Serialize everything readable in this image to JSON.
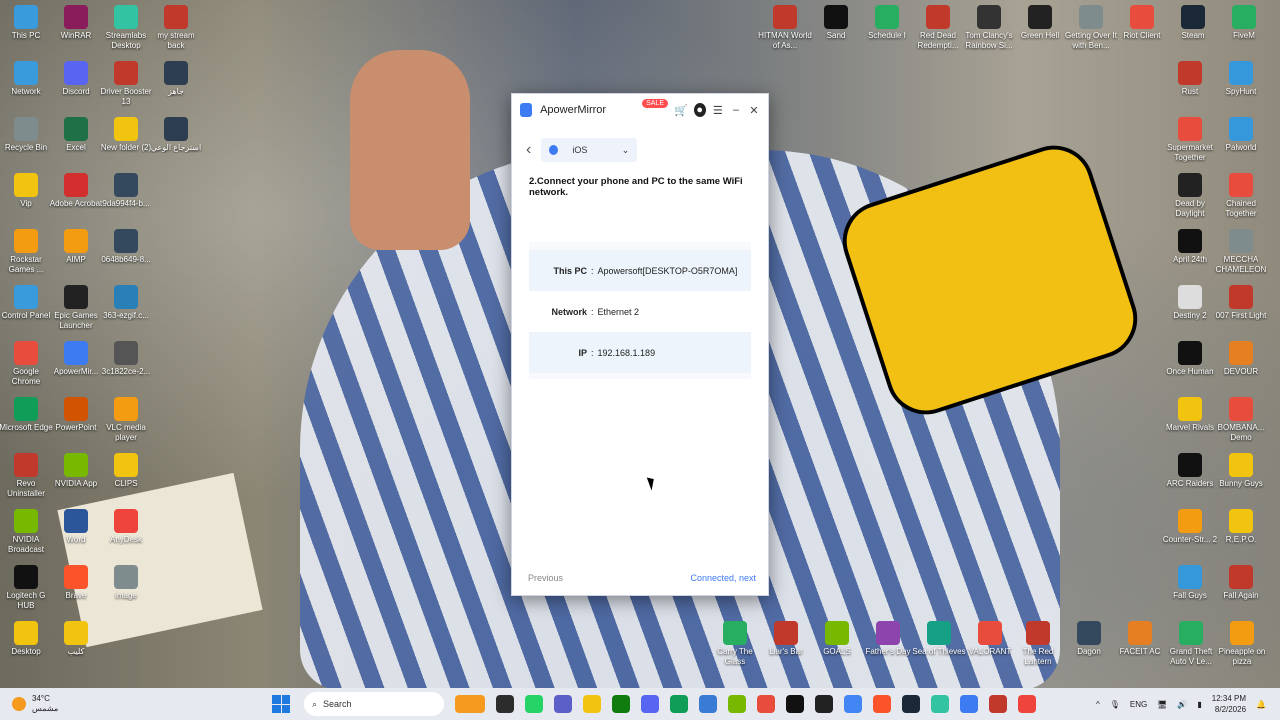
{
  "desktop": {
    "left_icons": [
      {
        "label": "This PC",
        "color": "#3a9bdc"
      },
      {
        "label": "WinRAR",
        "color": "#8a1c5c"
      },
      {
        "label": "Streamlabs Desktop",
        "color": "#31c3a2"
      },
      {
        "label": "my stream back",
        "color": "#c0392b"
      },
      {
        "label": "Network",
        "color": "#3a9bdc"
      },
      {
        "label": "Discord",
        "color": "#5865f2"
      },
      {
        "label": "Driver Booster 13",
        "color": "#c0392b"
      },
      {
        "label": "جاهز",
        "color": "#2c3e50"
      },
      {
        "label": "Recycle Bin",
        "color": "#7f8c8d"
      },
      {
        "label": "Excel",
        "color": "#1e7145"
      },
      {
        "label": "New folder (2)",
        "color": "#f1c40f"
      },
      {
        "label": "استرجاع الوعي",
        "color": "#2c3e50"
      },
      {
        "label": "Vip",
        "color": "#f1c40f"
      },
      {
        "label": "Adobe Acrobat",
        "color": "#d32f2f"
      },
      {
        "label": "9da994f4-b...",
        "color": "#34495e"
      },
      {
        "label": "Rockstar Games ...",
        "color": "#f39c12"
      },
      {
        "label": "AIMP",
        "color": "#f39c12"
      },
      {
        "label": "0648b649-8...",
        "color": "#34495e"
      },
      {
        "label": "Control Panel",
        "color": "#3a9bdc"
      },
      {
        "label": "Epic Games Launcher",
        "color": "#222"
      },
      {
        "label": "363-ezgif.c...",
        "color": "#2980b9"
      },
      {
        "label": "Google Chrome",
        "color": "#e74c3c"
      },
      {
        "label": "ApowerMir...",
        "color": "#3d7bf2"
      },
      {
        "label": "3c1822ce-2...",
        "color": "#555"
      },
      {
        "label": "Microsoft Edge",
        "color": "#0f9d58"
      },
      {
        "label": "PowerPoint",
        "color": "#d35400"
      },
      {
        "label": "VLC media player",
        "color": "#f39c12"
      },
      {
        "label": "Revo Uninstaller",
        "color": "#c0392b"
      },
      {
        "label": "NVIDIA App",
        "color": "#76b900"
      },
      {
        "label": "CLIPS",
        "color": "#f1c40f"
      },
      {
        "label": "NVIDIA Broadcast",
        "color": "#76b900"
      },
      {
        "label": "Word",
        "color": "#2b579a"
      },
      {
        "label": "AnyDesk",
        "color": "#ef443b"
      },
      {
        "label": "Logitech G HUB",
        "color": "#111"
      },
      {
        "label": "Brave",
        "color": "#fb542b"
      },
      {
        "label": "image",
        "color": "#7f8c8d"
      },
      {
        "label": "Desktop",
        "color": "#f1c40f"
      },
      {
        "label": "كليب",
        "color": "#f1c40f"
      }
    ],
    "right_icons": [
      {
        "label": "HITMAN World of As...",
        "color": "#c0392b"
      },
      {
        "label": "Sand",
        "color": "#111"
      },
      {
        "label": "Schedule I",
        "color": "#27ae60"
      },
      {
        "label": "Red Dead Redempti...",
        "color": "#c0392b"
      },
      {
        "label": "Tom Clancy's Rainbow Si...",
        "color": "#333"
      },
      {
        "label": "Green Hell",
        "color": "#222"
      },
      {
        "label": "Getting Over It with Ben...",
        "color": "#7f8c8d"
      },
      {
        "label": "Riot Client",
        "color": "#e74c3c"
      },
      {
        "label": "Steam",
        "color": "#1b2838"
      },
      {
        "label": "FiveM",
        "color": "#27ae60"
      },
      {
        "label": "Rust",
        "color": "#c0392b"
      },
      {
        "label": "SpyHunt",
        "color": "#3498db"
      },
      {
        "label": "Supermarket Together",
        "color": "#e74c3c"
      },
      {
        "label": "Palworld",
        "color": "#3498db"
      },
      {
        "label": "Dead by Daylight",
        "color": "#222"
      },
      {
        "label": "Chained Together",
        "color": "#e74c3c"
      },
      {
        "label": "April 24th",
        "color": "#111"
      },
      {
        "label": "MECCHA CHAMELEON",
        "color": "#7f8c8d"
      },
      {
        "label": "Destiny 2",
        "color": "#ddd"
      },
      {
        "label": "007 First Light",
        "color": "#c0392b"
      },
      {
        "label": "Once Human",
        "color": "#111"
      },
      {
        "label": "DEVOUR",
        "color": "#e67e22"
      },
      {
        "label": "Marvel Rivals",
        "color": "#f1c40f"
      },
      {
        "label": "BOMBANA... Demo",
        "color": "#e74c3c"
      },
      {
        "label": "ARC Raiders",
        "color": "#111"
      },
      {
        "label": "Bunny Guys",
        "color": "#f1c40f"
      },
      {
        "label": "Counter-Str... 2",
        "color": "#f39c12"
      },
      {
        "label": "R.E.P.O.",
        "color": "#f1c40f"
      },
      {
        "label": "Fall Guys",
        "color": "#3498db"
      },
      {
        "label": "Fall Again",
        "color": "#c0392b"
      },
      {
        "label": "Carry The Glass",
        "color": "#27ae60"
      },
      {
        "label": "Liar's Bar",
        "color": "#c0392b"
      },
      {
        "label": "GOALS",
        "color": "#76b900"
      },
      {
        "label": "Father's Day",
        "color": "#8e44ad"
      },
      {
        "label": "Sea of Thieves",
        "color": "#16a085"
      },
      {
        "label": "VALORANT",
        "color": "#e74c3c"
      },
      {
        "label": "The Red Lantern",
        "color": "#c0392b"
      },
      {
        "label": "Dagon",
        "color": "#34495e"
      },
      {
        "label": "FACEIT AC",
        "color": "#e67e22"
      },
      {
        "label": "Grand Theft Auto V Le...",
        "color": "#27ae60"
      },
      {
        "label": "Pineapple on pizza",
        "color": "#f39c12"
      }
    ]
  },
  "app": {
    "title": "ApowerMirror",
    "sale_badge": "SALE",
    "device_select": "iOS",
    "step_text": "2.Connect your phone and PC to the same WiFi network.",
    "info": [
      {
        "key": "This PC",
        "value": "Apowersoft[DESKTOP-O5R7OMA]"
      },
      {
        "key": "Network",
        "value": "Ethernet 2"
      },
      {
        "key": "IP",
        "value": "192.168.1.189"
      }
    ],
    "previous_label": "Previous",
    "next_label": "Connected, next"
  },
  "taskbar": {
    "weather_temp": "34°C",
    "weather_desc": "مشمس",
    "search_placeholder": "Search",
    "lang": "ENG",
    "time": "12:34 PM",
    "date": "8/2/2026",
    "apps": [
      "#f59a1c",
      "#2c2c2c",
      "#25d366",
      "#5b5fc7",
      "#f1c40f",
      "#107c10",
      "#5865f2",
      "#0f9d58",
      "#3a7bd5",
      "#76b900",
      "#e74c3c",
      "#111",
      "#222",
      "#4285f4",
      "#fb542b",
      "#1b2838",
      "#31c3a2",
      "#3d7bf2",
      "#c0392b",
      "#ef443b"
    ]
  }
}
